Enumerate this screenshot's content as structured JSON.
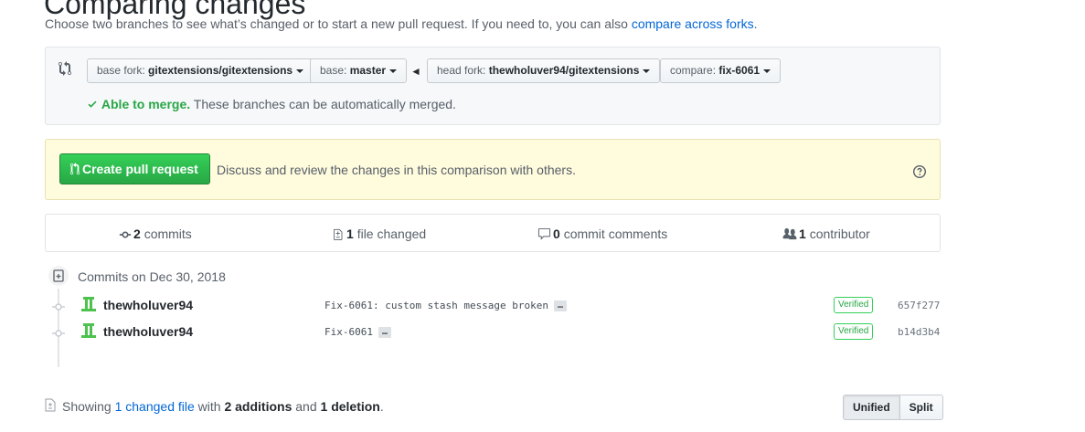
{
  "header": {
    "title": "Comparing changes",
    "subtitle_prefix": "Choose two branches to see what’s changed or to start a new pull request. If you need to, you can also ",
    "subtitle_link": "compare across forks",
    "subtitle_suffix": "."
  },
  "range": {
    "icon": "compare-icon",
    "base_fork_label": "base fork:",
    "base_fork_value": "gitextensions/gitextensions",
    "base_label": "base:",
    "base_value": "master",
    "arrow": "◄",
    "head_fork_label": "head fork:",
    "head_fork_value": "thewholuver94/gitextensions",
    "compare_label": "compare:",
    "compare_value": "fix-6061",
    "merge_status": "Able to merge.",
    "merge_message": "These branches can be automatically merged."
  },
  "flash": {
    "button_label": "Create pull request",
    "message": "Discuss and review the changes in this comparison with others."
  },
  "numbers": {
    "commits_count": "2",
    "commits_label": "commits",
    "files_count": "1",
    "files_label": "file changed",
    "comments_count": "0",
    "comments_label": "commit comments",
    "contributors_count": "1",
    "contributors_label": "contributor"
  },
  "commits": {
    "date_label": "Commits on Dec 30, 2018",
    "items": [
      {
        "author": "thewholuver94",
        "message": "Fix-6061: custom stash message broken",
        "ellipsis": "…",
        "badge": "Verified",
        "sha": "657f277"
      },
      {
        "author": "thewholuver94",
        "message": "Fix-6061",
        "ellipsis": "…",
        "badge": "Verified",
        "sha": "b14d3b4"
      }
    ]
  },
  "diffstat": {
    "prefix": "Showing ",
    "link": "1 changed file",
    "middle": " with ",
    "additions": "2 additions",
    "and": " and ",
    "deletions": "1 deletion",
    "suffix": "."
  },
  "view_toggle": {
    "unified_label": "Unified",
    "split_label": "Split"
  },
  "colors": {
    "link": "#0366d6",
    "success": "#28a745",
    "flash_bg": "#fffbdd"
  }
}
